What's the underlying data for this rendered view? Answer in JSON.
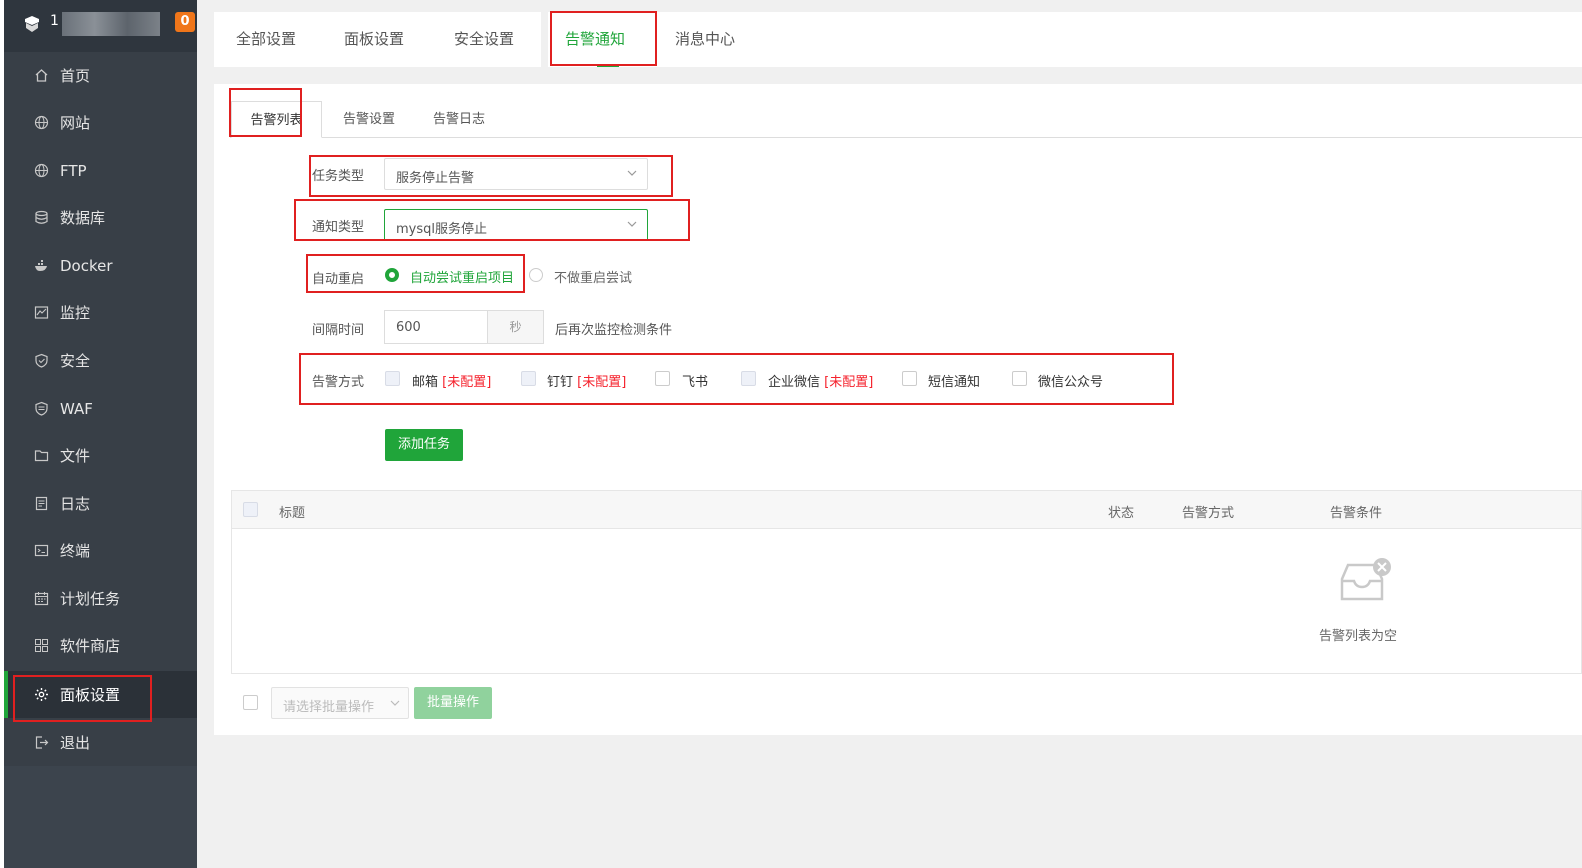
{
  "sidebar": {
    "user": "1",
    "badge": "0",
    "items": [
      {
        "label": "首页",
        "icon": "home-icon"
      },
      {
        "label": "网站",
        "icon": "globe-icon"
      },
      {
        "label": "FTP",
        "icon": "globe-icon"
      },
      {
        "label": "数据库",
        "icon": "database-icon"
      },
      {
        "label": "Docker",
        "icon": "docker-icon"
      },
      {
        "label": "监控",
        "icon": "monitor-icon"
      },
      {
        "label": "安全",
        "icon": "shield-icon"
      },
      {
        "label": "WAF",
        "icon": "waf-shield-icon"
      },
      {
        "label": "文件",
        "icon": "folder-icon"
      },
      {
        "label": "日志",
        "icon": "log-icon"
      },
      {
        "label": "终端",
        "icon": "terminal-icon"
      },
      {
        "label": "计划任务",
        "icon": "calendar-icon"
      },
      {
        "label": "软件商店",
        "icon": "apps-icon"
      },
      {
        "label": "面板设置",
        "icon": "gear-icon"
      },
      {
        "label": "退出",
        "icon": "logout-icon"
      }
    ]
  },
  "top_tabs": [
    "全部设置",
    "面板设置",
    "安全设置",
    "告警通知",
    "消息中心"
  ],
  "sub_tabs": [
    "告警列表",
    "告警设置",
    "告警日志"
  ],
  "form": {
    "task_type_label": "任务类型",
    "task_type_value": "服务停止告警",
    "notify_type_label": "通知类型",
    "notify_type_value": "mysql服务停止",
    "restart_label": "自动重启",
    "restart_on": "自动尝试重启项目",
    "restart_off": "不做重启尝试",
    "interval_label": "间隔时间",
    "interval_value": "600",
    "interval_unit": "秒",
    "interval_suffix": "后再次监控检测条件",
    "method_label": "告警方式",
    "methods": [
      {
        "name": "邮箱",
        "note": "[未配置]"
      },
      {
        "name": "钉钉",
        "note": "[未配置]"
      },
      {
        "name": "飞书",
        "note": ""
      },
      {
        "name": "企业微信",
        "note": "[未配置]"
      },
      {
        "name": "短信通知",
        "note": ""
      },
      {
        "name": "微信公众号",
        "note": ""
      }
    ],
    "add_button": "添加任务"
  },
  "table": {
    "headers": [
      "标题",
      "状态",
      "告警方式",
      "告警条件"
    ],
    "empty_text": "告警列表为空"
  },
  "bulk": {
    "placeholder": "请选择批量操作",
    "button": "批量操作"
  },
  "colors": {
    "accent": "#20a53a",
    "sidebar": "#383f47",
    "annotation": "#e02020",
    "warning": "#f5222d"
  }
}
